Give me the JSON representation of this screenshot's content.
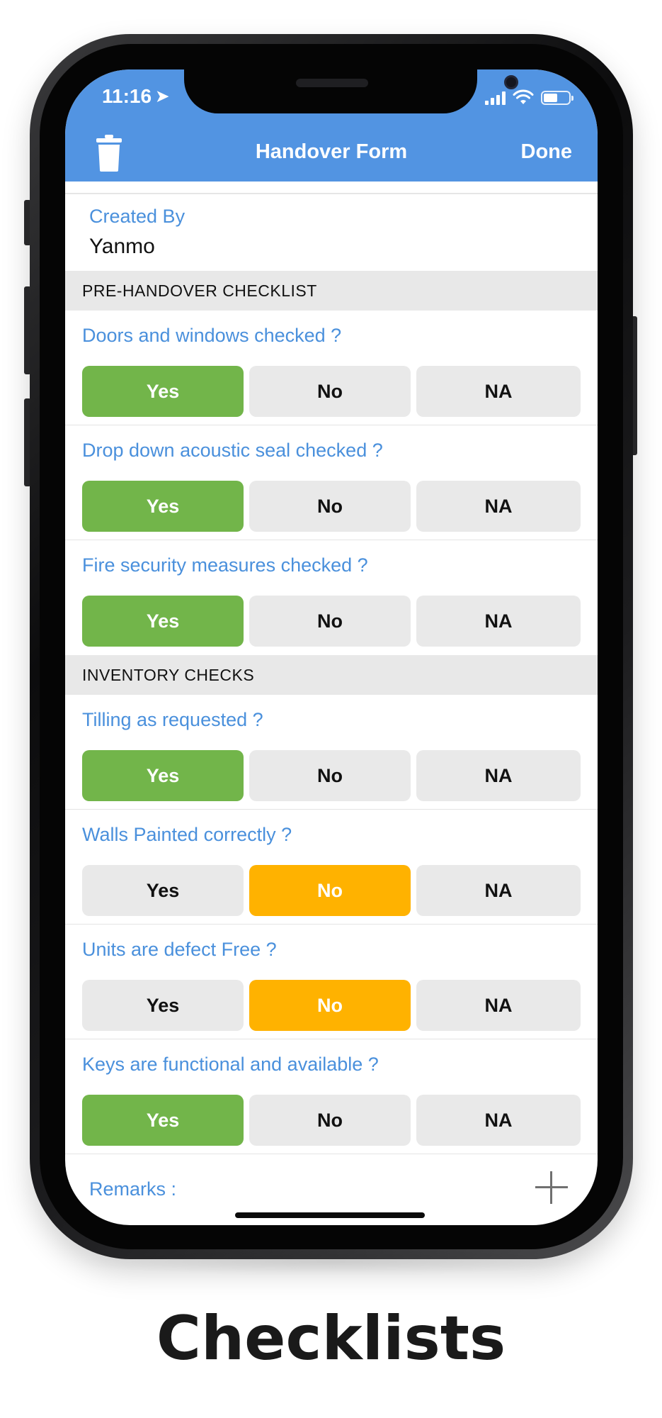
{
  "status_bar": {
    "time": "11:16",
    "location_icon": "location-arrow-icon",
    "signal_icon": "cellular-signal-icon",
    "wifi_icon": "wifi-icon",
    "battery_icon": "battery-icon"
  },
  "nav": {
    "title": "Handover Form",
    "done_label": "Done",
    "trash_icon": "trash-icon"
  },
  "created_by": {
    "label": "Created By",
    "value": "Yanmo"
  },
  "sections": [
    {
      "header": "PRE-HANDOVER CHECKLIST",
      "questions": [
        {
          "label": "Doors and windows checked ?",
          "options": [
            "Yes",
            "No",
            "NA"
          ],
          "selected": "Yes"
        },
        {
          "label": "Drop down acoustic seal checked ?",
          "options": [
            "Yes",
            "No",
            "NA"
          ],
          "selected": "Yes"
        },
        {
          "label": "Fire security measures checked ?",
          "options": [
            "Yes",
            "No",
            "NA"
          ],
          "selected": "Yes"
        }
      ]
    },
    {
      "header": "INVENTORY CHECKS",
      "questions": [
        {
          "label": "Tilling as requested ?",
          "options": [
            "Yes",
            "No",
            "NA"
          ],
          "selected": "Yes"
        },
        {
          "label": "Walls Painted correctly ?",
          "options": [
            "Yes",
            "No",
            "NA"
          ],
          "selected": "No"
        },
        {
          "label": "Units are defect Free ?",
          "options": [
            "Yes",
            "No",
            "NA"
          ],
          "selected": "No"
        },
        {
          "label": "Keys are functional and available ?",
          "options": [
            "Yes",
            "No",
            "NA"
          ],
          "selected": "Yes"
        }
      ]
    }
  ],
  "remarks": {
    "label": "Remarks :",
    "add_icon": "plus-icon"
  },
  "caption": "Checklists",
  "colors": {
    "nav_blue": "#5294e2",
    "label_blue": "#4a90dc",
    "yes_green": "#72b54a",
    "no_orange": "#ffb200",
    "option_gray": "#e9e9e9",
    "section_gray": "#e8e8e8"
  }
}
